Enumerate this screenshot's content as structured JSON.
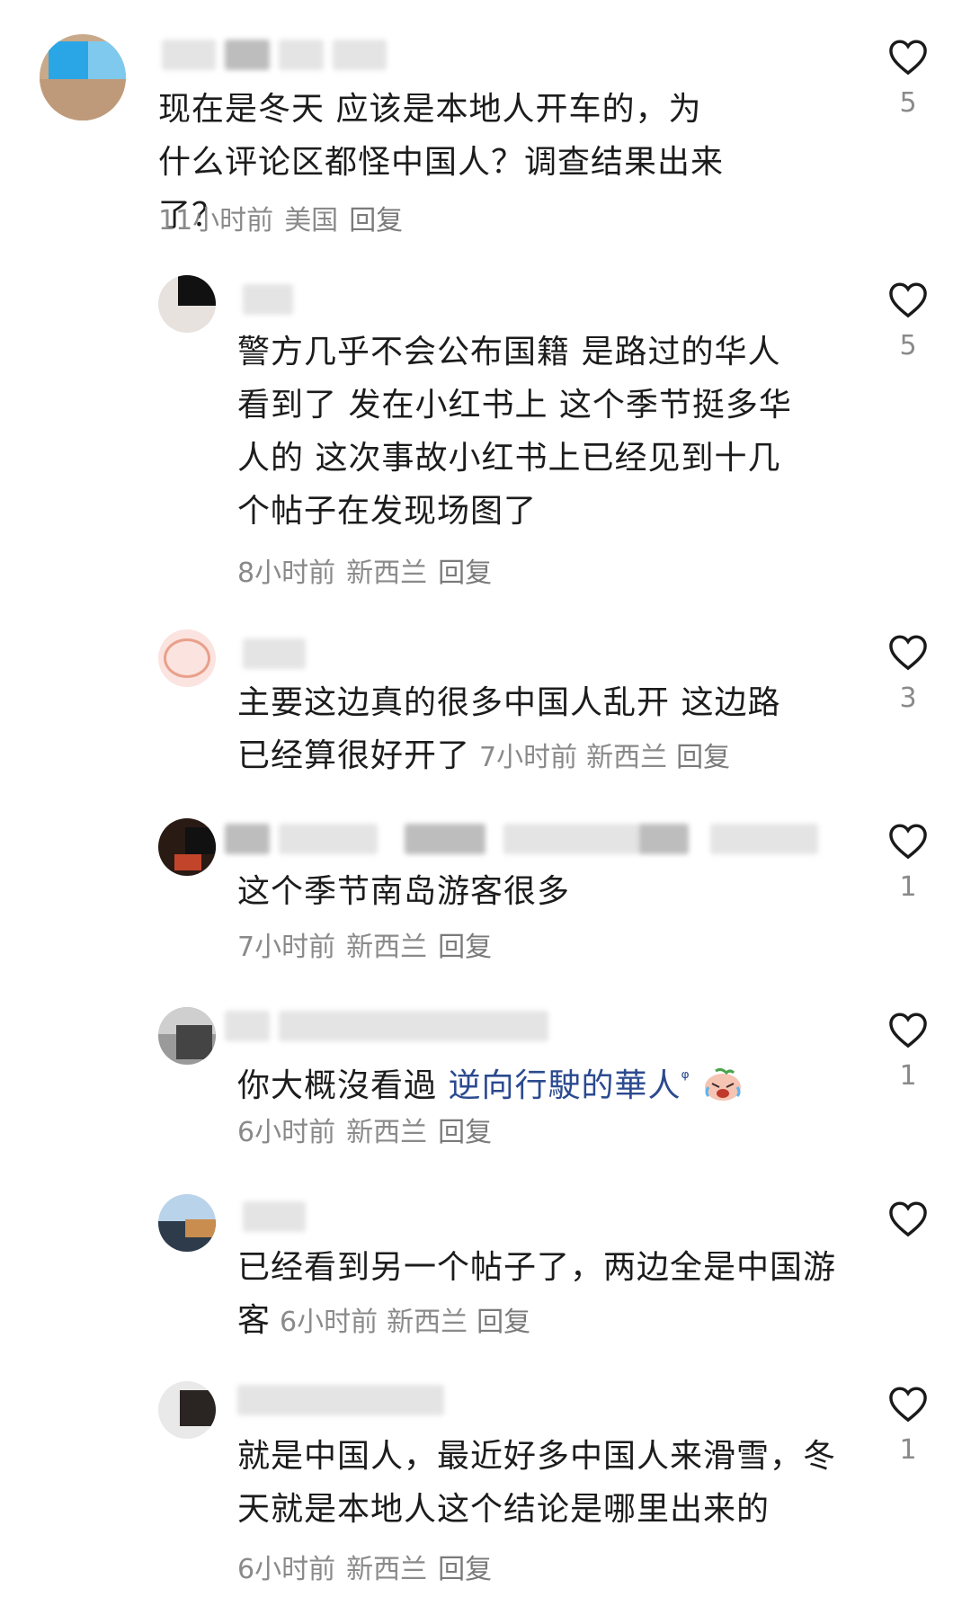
{
  "comments": [
    {
      "text": "现在是冬天 应该是本地人开车的，为什么评论区都怪中国人？调查结果出来了？",
      "time": "11小时前",
      "location": "美国",
      "reply": "回复",
      "likes": "5"
    },
    {
      "text": "警方几乎不会公布国籍 是路过的华人看到了 发在小红书上 这个季节挺多华人的 这次事故小红书上已经见到十几个帖子在发现场图了",
      "time": "8小时前",
      "location": "新西兰",
      "reply": "回复",
      "likes": "5"
    },
    {
      "text": "主要这边真的很多中国人乱开 这边路已经算很好开了",
      "time": "7小时前",
      "location": "新西兰",
      "reply": "回复",
      "likes": "3"
    },
    {
      "text": "这个季节南岛游客很多",
      "time": "7小时前",
      "location": "新西兰",
      "reply": "回复",
      "likes": "1"
    },
    {
      "text_prefix": "你大概沒看過 ",
      "link_text": "逆向行駛的華人",
      "emoji": "crying-laughing-face-icon",
      "time": "6小时前",
      "location": "新西兰",
      "reply": "回复",
      "likes": "1"
    },
    {
      "text": "已经看到另一个帖子了，两边全是中国游客",
      "time": "6小时前",
      "location": "新西兰",
      "reply": "回复",
      "likes": ""
    },
    {
      "text": "就是中国人，最近好多中国人来滑雪，冬天就是本地人这个结论是哪里出来的",
      "time": "6小时前",
      "location": "新西兰",
      "reply": "回复",
      "likes": "1"
    }
  ],
  "colors": {
    "text": "#1c1c1c",
    "meta": "#8a8a8a",
    "link": "#2b4a8f"
  },
  "icons": {
    "like": "heart-outline-icon",
    "search": "search-icon"
  }
}
